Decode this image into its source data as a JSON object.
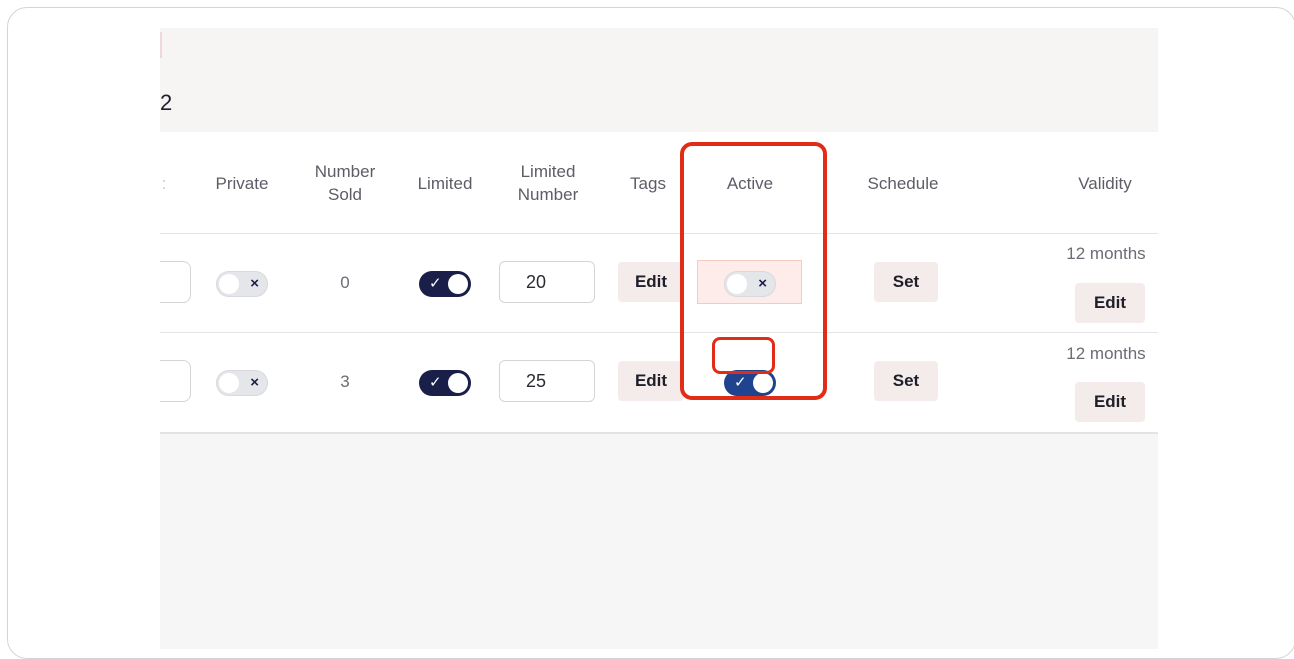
{
  "header": {
    "count": "2"
  },
  "table": {
    "columns": [
      "Private",
      "Number Sold",
      "Limited",
      "Limited Number",
      "Tags",
      "Active",
      "Schedule",
      "Validity"
    ],
    "rows": [
      {
        "private": false,
        "number_sold": "0",
        "limited": true,
        "limited_number": "20",
        "tags_button": "Edit",
        "active": false,
        "schedule_button": "Set",
        "validity": "12 months",
        "validity_button": "Edit"
      },
      {
        "private": false,
        "number_sold": "3",
        "limited": true,
        "limited_number": "25",
        "tags_button": "Edit",
        "active": true,
        "schedule_button": "Set",
        "validity": "12 months",
        "validity_button": "Edit"
      }
    ]
  },
  "icons": {
    "check": "✓",
    "cross": "×"
  },
  "colors": {
    "highlight": "#e12d18",
    "toggle_on_dark": "#1a1f4a",
    "toggle_on_blue": "#20438f",
    "button_bg": "#f3eceb"
  }
}
